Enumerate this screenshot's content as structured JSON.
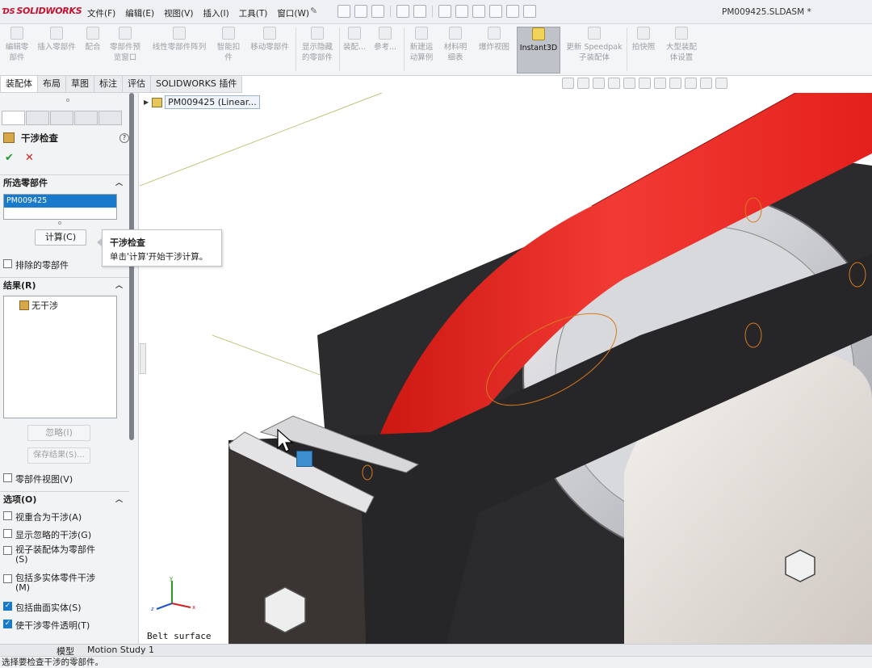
{
  "app": {
    "logo": "SOLIDWORKS",
    "menus": [
      "文件(F)",
      "编辑(E)",
      "视图(V)",
      "插入(I)",
      "工具(T)",
      "窗口(W)"
    ],
    "document_title": "PM009425.SLDASM *"
  },
  "command_bar": {
    "items": [
      {
        "label": "编辑零\n部件",
        "icon": "edit-component-icon"
      },
      {
        "label": "插入零部件",
        "icon": "insert-component-icon"
      },
      {
        "label": "配合",
        "icon": "mate-icon"
      },
      {
        "label": "零部件预\n览窗口",
        "icon": "preview-window-icon"
      },
      {
        "label": "线性零部件阵列",
        "icon": "linear-pattern-icon"
      },
      {
        "label": "智能扣\n件",
        "icon": "smart-fastener-icon"
      },
      {
        "label": "移动零部件",
        "icon": "move-component-icon"
      },
      {
        "label": "显示隐藏\n的零部件",
        "icon": "show-hidden-icon"
      },
      {
        "label": "装配...",
        "icon": "assembly-feature-icon"
      },
      {
        "label": "参考...",
        "icon": "reference-geometry-icon"
      },
      {
        "label": "新建运\n动算例",
        "icon": "new-motion-study-icon"
      },
      {
        "label": "材料明\n细表",
        "icon": "bom-icon"
      },
      {
        "label": "爆炸视图",
        "icon": "exploded-view-icon"
      },
      {
        "label": "Instant3D",
        "icon": "instant3d-icon"
      },
      {
        "label": "更新 Speedpak\n子装配体",
        "icon": "speedpak-icon"
      },
      {
        "label": "拍快照",
        "icon": "snapshot-icon"
      },
      {
        "label": "大型装配\n体设置",
        "icon": "large-assembly-icon"
      }
    ]
  },
  "tabs": [
    "装配体",
    "布局",
    "草图",
    "标注",
    "评估",
    "SOLIDWORKS 插件"
  ],
  "feature_tree": {
    "root_label": "PM009425 (Linear..."
  },
  "property_manager": {
    "title": "干涉检查",
    "help": "?",
    "ok": "✔",
    "cancel": "✕",
    "selected_components_header": "所选零部件",
    "selected_item": "PM009425",
    "calculate_button": "计算(C)",
    "excluded_components": "排除的零部件",
    "results_header": "结果(R)",
    "result_item": "无干涉",
    "ignore_button": "忽略(I)",
    "save_results_button": "保存结果(S)...",
    "component_view": "零部件视图(V)",
    "options_header": "选项(O)",
    "options": [
      {
        "label": "视重合为干涉(A)",
        "checked": false
      },
      {
        "label": "显示忽略的干涉(G)",
        "checked": false
      },
      {
        "label": "视子装配体为零部件\n(S)",
        "checked": false
      },
      {
        "label": "包括多实体零件干涉\n(M)",
        "checked": false
      },
      {
        "label": "包括曲面实体(S)",
        "checked": true
      },
      {
        "label": "使干涉零件透明(T)",
        "checked": true
      }
    ]
  },
  "tooltip": {
    "title": "干涉检查",
    "description": "单击'计算'开始干涉计算。"
  },
  "viewport": {
    "surface_label": "Belt surface",
    "colors": {
      "belt": "#e8201f",
      "frame": "#2c2c2c",
      "background": "#ffffff"
    }
  },
  "bottom_tabs": [
    "模型",
    "Motion Study 1"
  ],
  "status_bar": {
    "text": "选择要检查干涉的零部件。"
  }
}
